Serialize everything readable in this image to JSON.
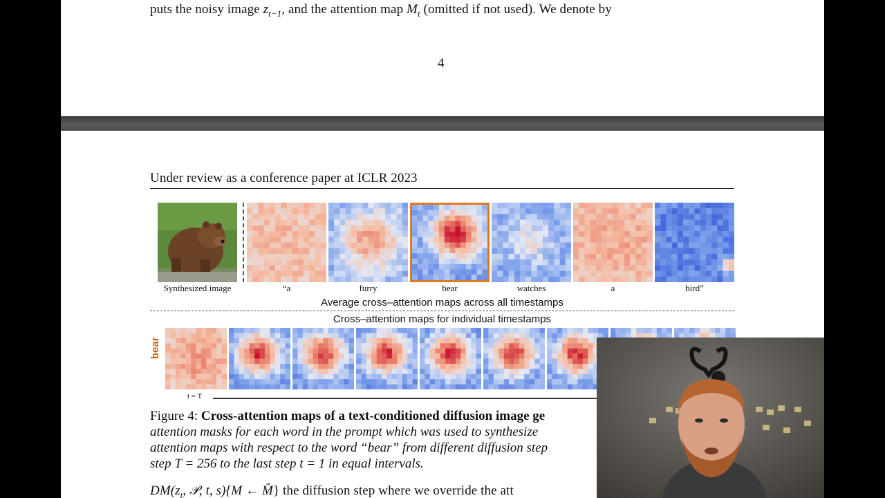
{
  "paper": {
    "top_line": {
      "pre": "puts the noisy image ",
      "z": "z",
      "z_sub": "t−1",
      "mid": ", and the attention map ",
      "M": "M",
      "M_sub": "t",
      "post": " (omitted if not used).   We denote by"
    },
    "page_number": "4",
    "header": "Under review as a conference paper at ICLR 2023",
    "figure": {
      "token_labels": [
        "Synthesized image",
        "“a",
        "furry",
        "bear",
        "watches",
        "a",
        "bird”"
      ],
      "avg_caption": "Average cross–attention maps across all timestamps",
      "ts_caption": "Cross–attention maps for individual  timestamps",
      "row_label": "bear",
      "timestep_start": "t = T",
      "highlight_color": "#e07a22",
      "cold_color": "#3b5fd9",
      "hot_color": "#c8102e"
    },
    "caption": {
      "label": "Figure 4: ",
      "bold": "Cross-attention maps of a text-conditioned diffusion image ge",
      "line2": "attention masks for each word in the prompt which was used to synthesize",
      "line3": "attention maps with respect to the word “bear” from different diffusion step",
      "line4": "step T = 256 to the last step t = 1 in equal intervals."
    },
    "bottom_line": {
      "pre": "DM(z",
      "z_sub": "t",
      "mid": ", 𝒫, t, s){M ← ",
      "Mhat": "M̂",
      "post": "} the diffusion step where we override the att"
    }
  }
}
